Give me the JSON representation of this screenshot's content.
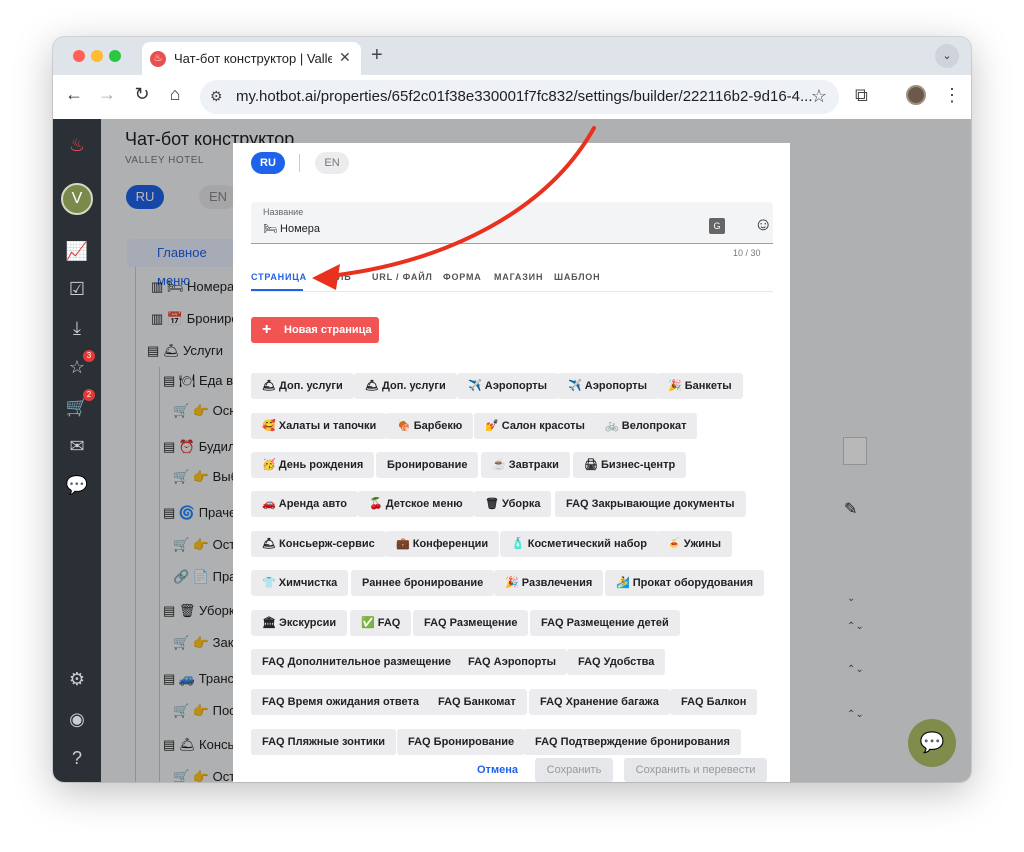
{
  "browser": {
    "tab_title": "Чат-бот конструктор | Valley",
    "url": "my.hotbot.ai/properties/65f2c01f38e330001f7fc832/settings/builder/222116b2-9d16-4..."
  },
  "background_page": {
    "title": "Чат-бот конструктор",
    "subtitle": "VALLEY HOTEL",
    "lang_ru": "RU",
    "lang_en": "EN",
    "main_menu": "Главное меню",
    "tree": [
      "🛏 Номера",
      "📅 Брониров",
      "🛎 Услуги",
      "🍽 Еда в",
      "👉 Осн",
      "⏰ Будил",
      "👉 Выб",
      "🌀 Праче",
      "👉 Ост",
      "📄 Пра",
      "🗑 Уборк",
      "👉 Зак",
      "🚙 Транс",
      "👉 Пос",
      "🛎 Консь",
      "👉 Ост"
    ],
    "sidenav_badges": [
      "3",
      "2"
    ]
  },
  "modal": {
    "lang_ru": "RU",
    "lang_en": "EN",
    "name_label": "Название",
    "name_value": "🛏 Номера",
    "counter": "10 / 30",
    "tabs": [
      "СТРАНИЦА",
      "ЦЕЛЬ",
      "URL / ФАЙЛ",
      "ФОРМА",
      "МАГАЗИН",
      "ШАБЛОН"
    ],
    "new_page": "Новая страница",
    "chips": [
      "🛎 Доп. услуги",
      "🛎 Доп. услуги",
      "✈️ Аэропорты",
      "✈️ Аэропорты",
      "🎉 Банкеты",
      "🥰 Халаты и тапочки",
      "🍖 Барбекю",
      "💅 Салон красоты",
      "🚲 Велопрокат",
      "🥳 День рождения",
      "Бронирование",
      "☕ Завтраки",
      "🖨 Бизнес-центр",
      "🚗 Аренда авто",
      "🍒 Детское меню",
      "🗑 Уборка",
      "FAQ Закрывающие документы",
      "🛎 Консьерж-сервис",
      "💼 Конференции",
      "🧴 Косметический набор",
      "🍝 Ужины",
      "👕 Химчистка",
      "Раннее бронирование",
      "🎉 Развлечения",
      "🏄 Прокат оборудования",
      "🏛 Экскурсии",
      "✅ FAQ",
      "FAQ Размещение",
      "FAQ Размещение детей",
      "FAQ Дополнительное размещение",
      "FAQ Аэропорты",
      "FAQ Удобства",
      "FAQ Время ожидания ответа",
      "FAQ Банкомат",
      "FAQ Хранение багажа",
      "FAQ Балкон",
      "FAQ Пляжные зонтики",
      "FAQ Бронирование",
      "FAQ Подтверждение бронирования"
    ],
    "cancel": "Отмена",
    "save": "Сохранить",
    "save_translate": "Сохранить и перевести"
  },
  "colors": {
    "accent": "#1e63e9",
    "new_page_button": "#f25454",
    "annotation_arrow": "#e8321e",
    "chat_bubble": "#7f8c4c"
  }
}
